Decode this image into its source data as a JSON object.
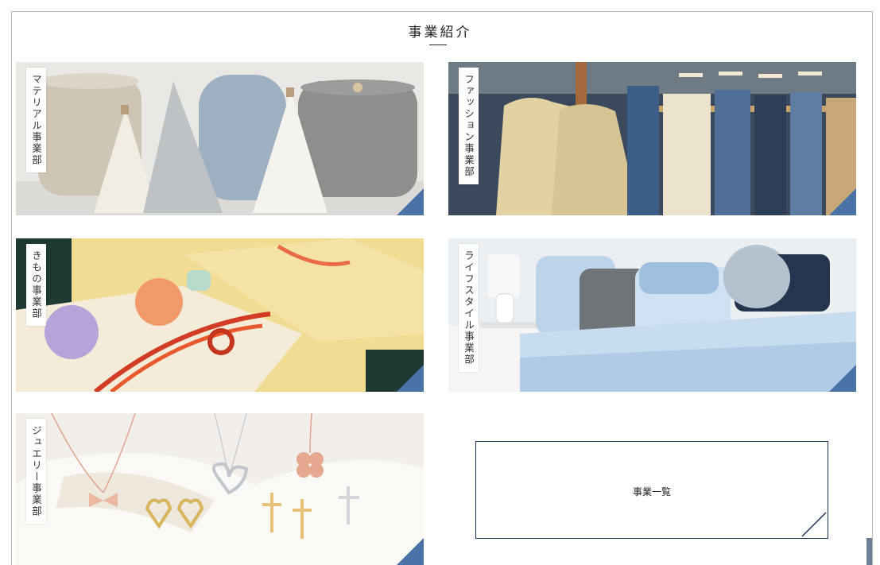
{
  "section": {
    "title": "事業紹介"
  },
  "cards": [
    {
      "label": "マテリアル事業部"
    },
    {
      "label": "ファッション事業部"
    },
    {
      "label": "きもの事業部"
    },
    {
      "label": "ライフスタイル事業部"
    },
    {
      "label": "ジュエリー事業部"
    }
  ],
  "list_button": {
    "label": "事業一覧"
  },
  "colors": {
    "accent": "#4a72a6",
    "border_navy": "#1a3358",
    "frame": "#b7b7b7"
  }
}
